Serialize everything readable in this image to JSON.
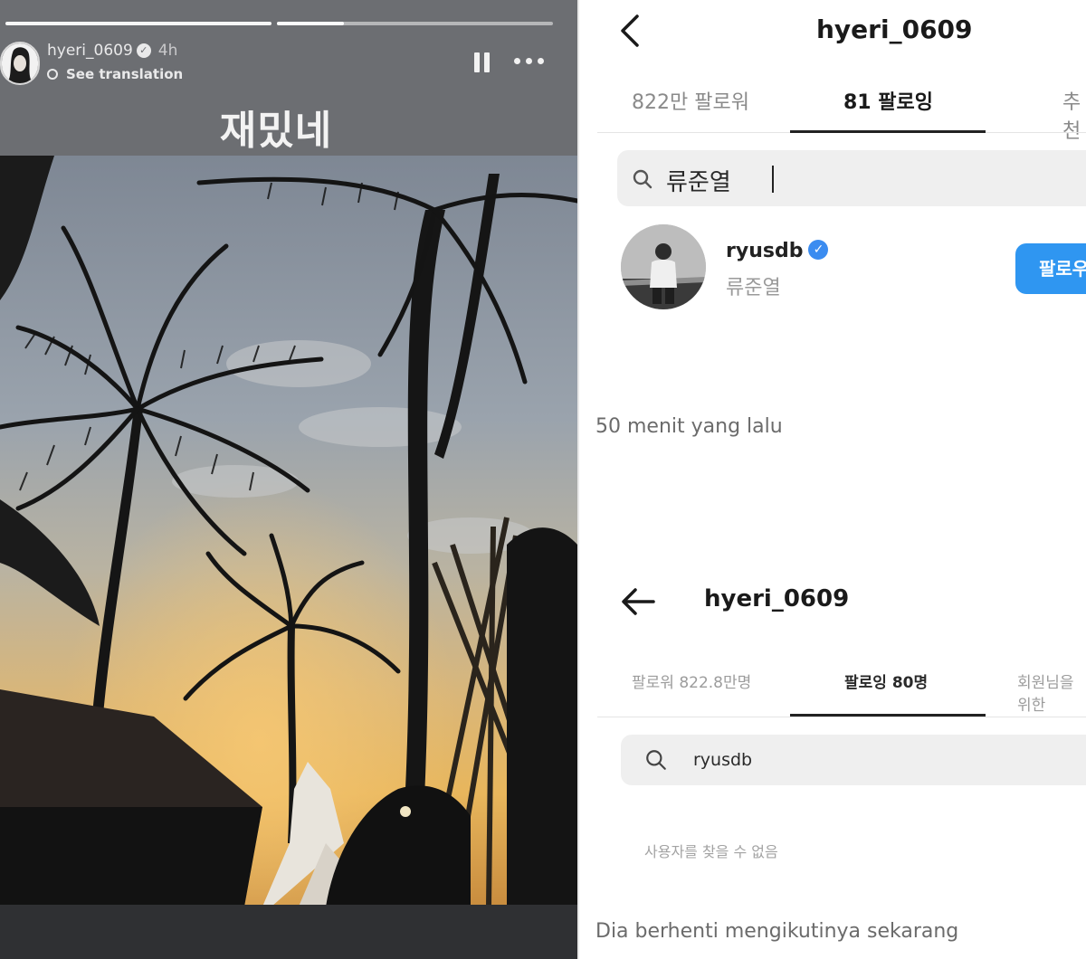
{
  "story": {
    "username": "hyeri_0609",
    "time": "4h",
    "see_translation": "See translation",
    "caption": "재밌네",
    "icons": [
      "pause-icon",
      "more-icon",
      "verified-icon",
      "translate-icon"
    ]
  },
  "panel1": {
    "title": "hyeri_0609",
    "tabs": [
      "822만 팔로워",
      "81 팔로잉",
      "추천"
    ],
    "search_value": "류준열",
    "result": {
      "username": "ryusdb",
      "name": "류준열",
      "follow_label": "팔로우"
    },
    "caption": "50 menit yang lalu"
  },
  "panel2": {
    "title": "hyeri_0609",
    "tabs": [
      "팔로워 822.8만명",
      "팔로잉 80명",
      "회원님을 위한"
    ],
    "search_value": "ryusdb",
    "empty_message": "사용자를 찾을 수 없음",
    "caption": "Dia berhenti mengikutinya sekarang"
  },
  "colors": {
    "accent": "#2f96f1",
    "verified": "#3b8cf0",
    "story_header": "#6c6e72"
  }
}
